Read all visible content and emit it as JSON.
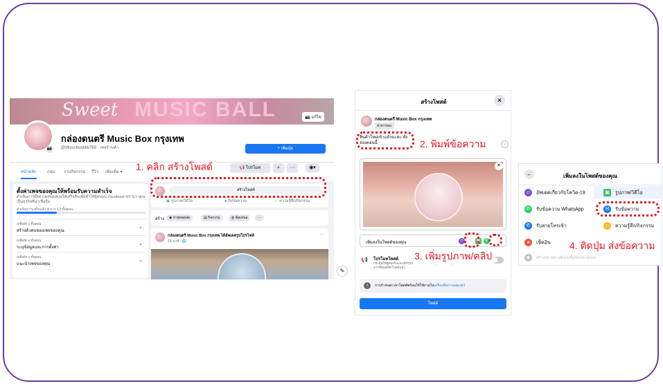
{
  "fb_page": {
    "cover_text_1": "Sweet",
    "cover_text_2": "MUSIC BALL",
    "edit_cover": "แก้ไข",
    "page_name": "กล่องดนตรี Music Box กรุงเทพ",
    "handle": "@Musicboxbkk789 · เพจร้านค้า",
    "add_button": "+ เพิ่มปุ่ม",
    "nav": [
      "หน้าหลัก",
      "กลุ่ม",
      "งานกิจกรรม",
      "รีวิว",
      "เพิ่มเติม ▾"
    ],
    "promote_button": "📢 โปรโมท",
    "search_icon": "⌕",
    "more_icon": "···",
    "setup_title": "ตั้งค่าเพจของคุณให้พร้อมรับความสำเร็จ",
    "setup_desc": "ดำเนินการตั้งค่าเพจของคุณให้เสร็จสิ้นเพื่อทำให้ผู้คนบน Facebook ทราบว่าคุณเป็นธุรกิจที่น่าเชื่อถือ",
    "setup_note": "ดำเนินการเสร็จแล้ว 4 จาก 13 ขั้นตอน",
    "progress": 0.31,
    "setup_items": [
      {
        "step": "เหลืออีก 1 ขั้นตอน",
        "title": "สร้างตัวตนของเพจของคุณ"
      },
      {
        "step": "เหลืออีก 6 ขั้นตอน",
        "title": "ระบุข้อมูลและการตั้งค่า"
      },
      {
        "step": "เหลืออีก 2 ขั้นตอน",
        "title": "แนะนำเพจของคุณ"
      }
    ],
    "create_post": "สร้างโพสต์",
    "composer_actions": [
      "รูปภาพ/วิดีโอ",
      "รับข้อความ",
      "ความรู้สึก/กิจกรรม"
    ],
    "action_bar": [
      "สร้าง",
      "ถ่ายทอดสด",
      "กิจกรรม",
      "ข้อเสนอ",
      "···"
    ],
    "post_name": "กล่องดนตรี Music Box กรุงเทพ ได้อัพเดตรูปโปรไฟล์",
    "post_time": "18 นาที · 🌐"
  },
  "steps": {
    "step1": "1. คลิก สร้างโพสต์",
    "step2": "2. พิมพ์ข้อความ",
    "step3": "3. เพิ่มรูปภาพ/คลิป",
    "step4": "4. ติดปุ่ม ส่งข้อความ"
  },
  "dialog": {
    "title": "สร้างโพสต์",
    "close": "✕",
    "name": "กล่องดนตรี Music Box กรุงเทพ",
    "audience": "สาธารณะ",
    "text": "สินค้าใหม่เข้าแล้วนะคะ สั่งจองตอนนี้",
    "add_to_post": "เพิ่มลงในโพสต์ของคุณ",
    "promote_title": "โปรโมทโพสต์",
    "promote_desc": "กระตุ้นให้ผู้คนเห็นและมีส่วนร่วมกับโพสต์ของคุณมากขึ้น คุณจะเลือกการตั้งค่าหลังจากที่คุณคลิกโพสต์แล้ว",
    "schedule_text": "การกำหนดเวลาโพสต์พร้อมให้ใช้งานใน",
    "schedule_link": "เครื่องมือการเผยแพร่",
    "post_button": "โพสต์"
  },
  "add_panel": {
    "title": "เพิ่มลงในโพสต์ของคุณ",
    "back": "←",
    "items": [
      {
        "label": "อัพเดตเกี่ยวกับโควิด-19",
        "icon": "covid-icon",
        "color": "#7b4fd6"
      },
      {
        "label": "รูปภาพ/วิดีโอ",
        "icon": "photo-icon",
        "color": "#45bd62"
      },
      {
        "label": "รับข้อความ WhatsApp",
        "icon": "whatsapp-icon",
        "color": "#25d366"
      },
      {
        "label": "รับข้อความ",
        "icon": "messenger-icon",
        "color": "#1877f2"
      },
      {
        "label": "รับสายโทรเข้า",
        "icon": "phone-icon",
        "color": "#1877f2"
      },
      {
        "label": "ความรู้สึก/กิจกรรม",
        "icon": "smile-icon",
        "color": "#f7b928"
      },
      {
        "label": "เช็คอิน",
        "icon": "location-icon",
        "color": "#f5533d"
      },
      {
        "label": "สร้างปลายทางอีเมลเพื่อขอแลกคูปอง",
        "icon": "tag-icon",
        "color": "#bcc0c4"
      }
    ]
  },
  "colors": {
    "accent": "#1877f2",
    "annotation": "#e4141e",
    "frame": "#6a3d9a"
  }
}
